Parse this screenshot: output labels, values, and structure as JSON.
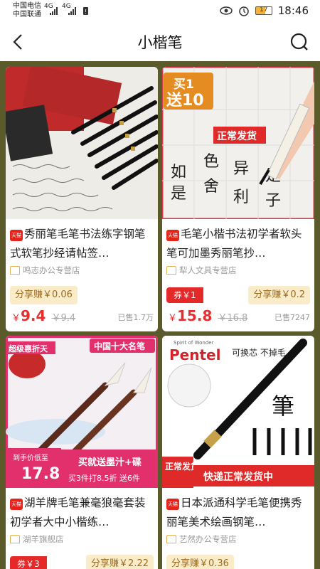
{
  "status_bar": {
    "carrier1": "中国电信",
    "carrier2": "中国联通",
    "net1": "4G",
    "net2": "4G",
    "battery": "17",
    "time": "18:46"
  },
  "header": {
    "title": "小楷笔"
  },
  "products": [
    {
      "title": "秀丽笔毛笔书法练字钢笔式软笔抄经请帖签…",
      "shop": "鸣志办公专营店",
      "share": "分享赚￥0.06",
      "coupon": "",
      "price_symbol": "￥",
      "price": "9.4",
      "original_price": "￥9.4",
      "sold": "已售1.7万",
      "badge": "天猫"
    },
    {
      "title": "毛笔小楷书法初学者软头笔可加墨秀丽笔抄…",
      "shop": "犁人文具专营店",
      "share": "分享赚￥0.2",
      "coupon": "券￥1",
      "price_symbol": "￥",
      "price": "15.8",
      "original_price": "￥16.8",
      "sold": "已售7247",
      "badge": "天猫",
      "img_text": {
        "promo_top": "买1",
        "promo_bottom": "送10",
        "tag": "正常发货"
      }
    },
    {
      "title": "湖羊牌毛笔兼毫狼毫套装初学者大中小楷练…",
      "shop": "湖羊旗舰店",
      "share": "分享赚￥2.22",
      "coupon": "券￥3",
      "badge": "天猫",
      "img_text": {
        "corner": "超级惠折天",
        "banner": "中国十大名笔",
        "hand_label": "到手价低至",
        "hand_price": "17.8",
        "promo1": "买就送墨汁+碟",
        "promo2": "买3件打8.5折 送6件"
      }
    },
    {
      "title": "日本派通科学毛笔便携秀丽笔美术绘画钢笔…",
      "shop": "艺然办公专营店",
      "share": "分享赚￥0.36",
      "coupon": "",
      "badge": "天猫",
      "img_text": {
        "brand_small": "Spirit of Wonder",
        "brand": "Pentel",
        "slogan": "可换芯 不掉毛",
        "kanji": "筆",
        "tag": "正常发货",
        "banner": "快递正常发货中"
      }
    }
  ]
}
